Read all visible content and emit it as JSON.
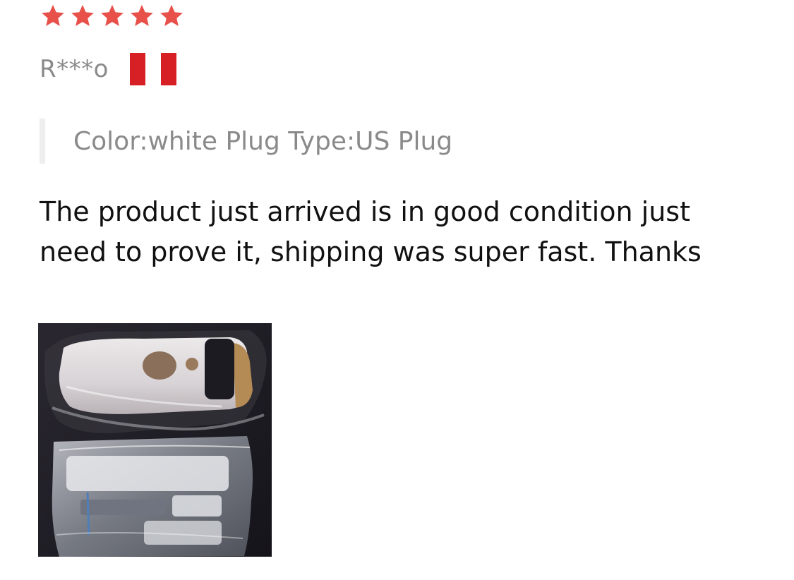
{
  "review": {
    "rating": 5,
    "rating_max": 5,
    "star_color": "#e8504a",
    "reviewer_name": "R***o",
    "country_flag": {
      "icon": "peru-flag-icon",
      "colors": [
        "#d71f26",
        "#ffffff",
        "#d71f26"
      ]
    },
    "sku_info": "Color:white Plug Type:US Plug",
    "text": "The product just arrived is in good condition just need to prove it, shipping was super fast. Thanks",
    "photos": [
      {
        "icon": "review-photo-thumbnail"
      }
    ]
  }
}
